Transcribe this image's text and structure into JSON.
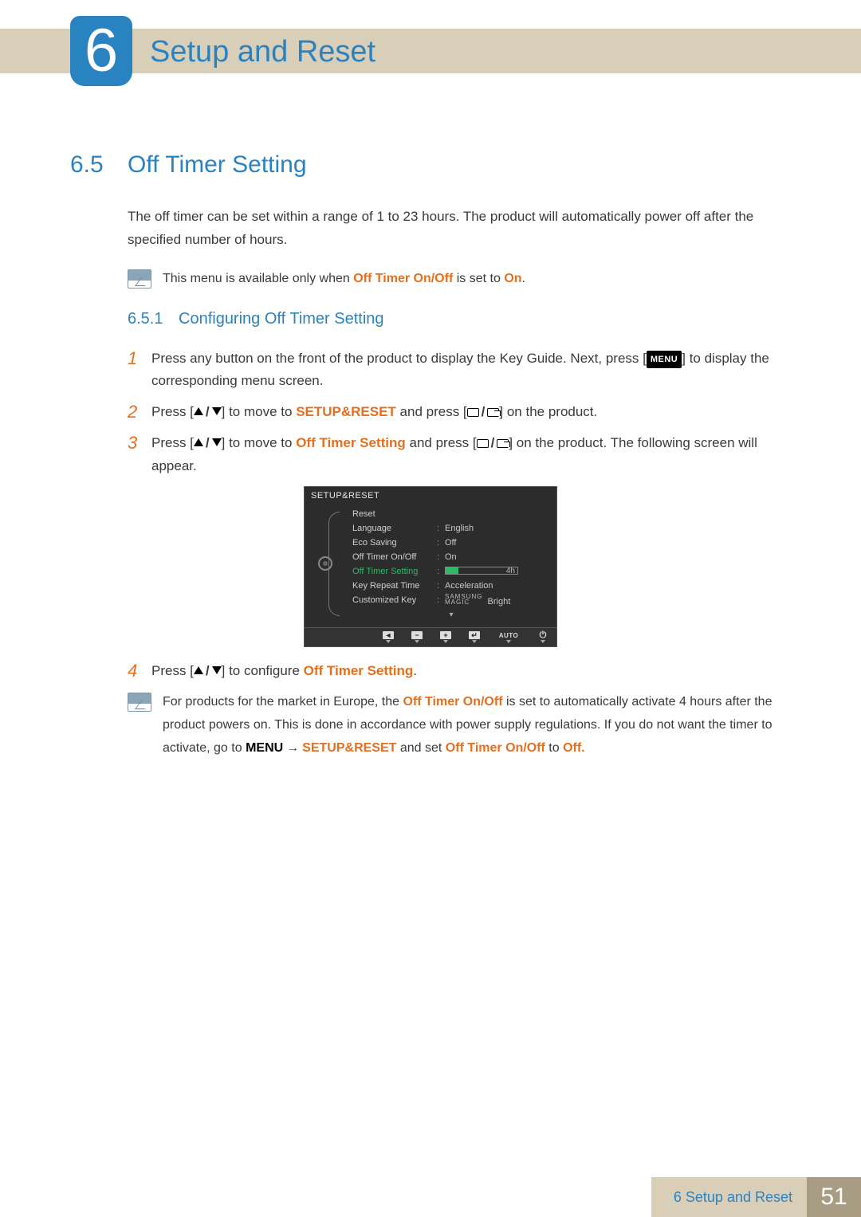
{
  "chapter": {
    "number": "6",
    "title": "Setup and Reset"
  },
  "section": {
    "number": "6.5",
    "title": "Off Timer Setting"
  },
  "intro": "The off timer can be set within a range of 1 to 23 hours. The product will automatically power off after the specified number of hours.",
  "note1": {
    "pre": "This menu is available only when ",
    "b1": "Off Timer On/Off",
    "mid": " is set to ",
    "b2": "On",
    "post": "."
  },
  "subsection": {
    "number": "6.5.1",
    "title": "Configuring Off Timer Setting"
  },
  "steps": {
    "s1": {
      "n": "1",
      "a": "Press any button on the front of the product to display the Key Guide. Next, press [",
      "menu": "MENU",
      "b": "] to display the corresponding menu screen."
    },
    "s2": {
      "n": "2",
      "a": "Press [",
      "b": "] to move to ",
      "target": "SETUP&RESET",
      "c": " and press [",
      "d": "] on the product."
    },
    "s3": {
      "n": "3",
      "a": "Press [",
      "b": "] to move to ",
      "target": "Off Timer Setting",
      "c": " and press [",
      "d": "] on the product. The following screen will appear."
    },
    "s4": {
      "n": "4",
      "a": "Press [",
      "b": "] to configure ",
      "target": "Off Timer Setting",
      "c": "."
    }
  },
  "osd": {
    "title": "SETUP&RESET",
    "rows": {
      "reset": {
        "label": "Reset",
        "value": ""
      },
      "language": {
        "label": "Language",
        "value": "English"
      },
      "eco": {
        "label": "Eco Saving",
        "value": "Off"
      },
      "onoff": {
        "label": "Off Timer On/Off",
        "value": "On"
      },
      "setting": {
        "label": "Off Timer Setting",
        "slider_text": "4h",
        "fill_pct": 18
      },
      "repeat": {
        "label": "Key Repeat Time",
        "value": "Acceleration"
      },
      "custom": {
        "label": "Customized Key",
        "magic_top": "SAMSUNG",
        "magic_bot": "MAGIC",
        "value": " Bright"
      }
    },
    "footer": {
      "back": "◄",
      "minus": "−",
      "plus": "+",
      "enter": "↵",
      "auto": "AUTO"
    }
  },
  "note2": {
    "a": "For products for the market in Europe, the ",
    "b1": "Off Timer On/Off",
    "b": " is set to automatically activate 4 hours after the product powers on. This is done in accordance with power supply regulations. If you do not want the timer to activate, go to ",
    "menu": "MENU",
    "arrow": "→",
    "sr": "SETUP&RESET",
    "c": " and set ",
    "b2": "Off Timer On/Off",
    "d": " to ",
    "off": "Off."
  },
  "footer": {
    "text": "6 Setup and Reset",
    "page": "51"
  }
}
